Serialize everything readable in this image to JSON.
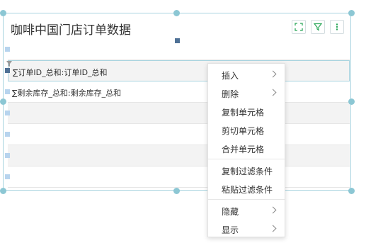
{
  "widget": {
    "title": "咖啡中国门店订单数据",
    "toolbar": {
      "expand_icon": "expand-icon",
      "filter_icon": "filter-icon",
      "more_icon": "more-vertical-icon"
    },
    "rows": [
      {
        "text": ""
      },
      {
        "text": "∑订单ID_总和:订单ID_总和"
      },
      {
        "text": "∑剩余库存_总和:剩余库存_总和"
      },
      {
        "text": ""
      },
      {
        "text": ""
      },
      {
        "text": ""
      },
      {
        "text": ""
      }
    ]
  },
  "context_menu": {
    "items": [
      {
        "label": "插入",
        "submenu": true
      },
      {
        "label": "删除",
        "submenu": true
      },
      {
        "label": "复制单元格",
        "submenu": false
      },
      {
        "label": "剪切单元格",
        "submenu": false
      },
      {
        "label": "合并单元格",
        "submenu": false
      },
      {
        "label": "复制过滤条件",
        "submenu": false
      },
      {
        "label": "粘贴过滤条件",
        "submenu": false
      },
      {
        "label": "隐藏",
        "submenu": true
      },
      {
        "label": "显示",
        "submenu": true
      }
    ]
  },
  "colors": {
    "accent_green": "#2ca85a",
    "selection_border": "#a9d4e0",
    "handle": "#8cc7d4"
  }
}
